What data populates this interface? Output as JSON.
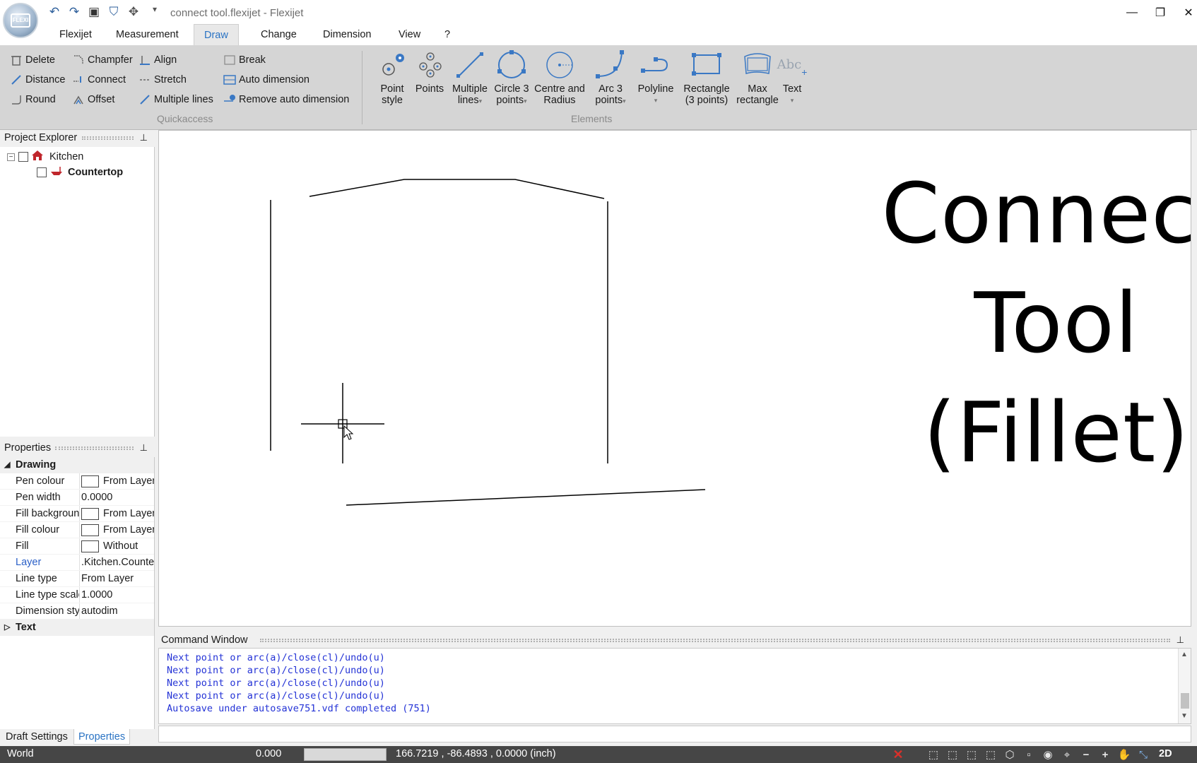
{
  "window": {
    "title": "connect tool.flexijet  -  Flexijet",
    "minimize_glyph": "—",
    "restore_glyph": "❐",
    "close_glyph": "✕",
    "orb_text": "FLEXI"
  },
  "quick_access": {
    "undo_icon": "↶",
    "redo_icon": "↷",
    "save_icon": "▣",
    "device_icon": "⛉",
    "gamepad_icon": "✥",
    "dropdown_icon": "▾"
  },
  "menu": {
    "tabs": [
      "Flexijet",
      "Measurement",
      "Draw",
      "Change",
      "Dimension",
      "View",
      "?"
    ],
    "active": "Draw"
  },
  "ribbon": {
    "quickaccess": {
      "label": "Quickaccess",
      "items": [
        "Delete",
        "Champfer",
        "Align",
        "Break",
        "Distance",
        "Connect",
        "Stretch",
        "Auto dimension",
        "Round",
        "Offset",
        "Multiple lines",
        "Remove auto dimension"
      ]
    },
    "elements": {
      "label": "Elements",
      "buttons": [
        {
          "line1": "Point",
          "line2": "style",
          "caret": ""
        },
        {
          "line1": "Points",
          "line2": "",
          "caret": ""
        },
        {
          "line1": "Multiple",
          "line2": "lines",
          "caret": "▾"
        },
        {
          "line1": "Circle 3",
          "line2": "points",
          "caret": "▾"
        },
        {
          "line1": "Centre and",
          "line2": "Radius",
          "caret": ""
        },
        {
          "line1": "Arc 3",
          "line2": "points",
          "caret": "▾"
        },
        {
          "line1": "Polyline",
          "line2": "",
          "caret": "▾"
        },
        {
          "line1": "Rectangle",
          "line2": "(3 points)",
          "caret": ""
        },
        {
          "line1": "Max",
          "line2": "rectangle",
          "caret": ""
        },
        {
          "line1": "Text",
          "line2": "",
          "caret": "▾"
        }
      ],
      "text_icon": "Abc"
    }
  },
  "project_explorer": {
    "title": "Project Explorer",
    "pin": "⊥",
    "expander": "−",
    "tree": [
      {
        "label": "Kitchen",
        "bold": false
      },
      {
        "label": "Countertop",
        "bold": true
      }
    ]
  },
  "properties": {
    "title": "Properties",
    "pin": "⊥",
    "category_drawing": "Drawing",
    "category_text": "Text",
    "tri_open": "◢",
    "tri_closed": "▷",
    "rows": [
      {
        "name": "Pen colour",
        "value": "From Layer",
        "swatch": true,
        "link": false
      },
      {
        "name": "Pen width",
        "value": "0.0000",
        "swatch": false,
        "link": false
      },
      {
        "name": "Fill background",
        "value": "From Layer",
        "swatch": true,
        "link": false
      },
      {
        "name": "Fill colour",
        "value": "From Layer",
        "swatch": true,
        "link": false
      },
      {
        "name": "Fill",
        "value": "Without",
        "swatch": true,
        "link": false
      },
      {
        "name": "Layer",
        "value": ".Kitchen.Countertop",
        "swatch": false,
        "link": true
      },
      {
        "name": "Line type",
        "value": "From Layer",
        "swatch": false,
        "link": false
      },
      {
        "name": "Line type scale",
        "value": "1.0000",
        "swatch": false,
        "link": false
      },
      {
        "name": "Dimension style",
        "value": "autodim",
        "swatch": false,
        "link": false
      }
    ]
  },
  "bottom_tabs": [
    "Draft Settings",
    "Properties"
  ],
  "canvas": {
    "overlay_lines": [
      "Connect",
      "Tool",
      "(Fillet)"
    ]
  },
  "command_window": {
    "title": "Command Window",
    "pin": "⊥",
    "lines": [
      "Next point or arc(a)/close(cl)/undo(u)",
      "Next point or arc(a)/close(cl)/undo(u)",
      "Next point or arc(a)/close(cl)/undo(u)",
      "Next point or arc(a)/close(cl)/undo(u)",
      "Autosave under autosave751.vdf completed (751)"
    ],
    "scroll_up": "▲",
    "scroll_down": "▼"
  },
  "status": {
    "space": "World",
    "value": "0.000",
    "coords": "166.7219 , -86.4893 , 0.0000 (inch)",
    "mode": "2D",
    "close_icon": "✕",
    "tool_icons": [
      "⬚",
      "⬚",
      "⬚",
      "⬚",
      "⬡",
      "▫",
      "◉",
      "⌖",
      "−",
      "+",
      "✋",
      "⤡"
    ]
  },
  "colors": {
    "accent": "#2a73c4",
    "command_text": "#2433d6",
    "status_bar": "#464646",
    "ribbon": "#d5d5d5",
    "close_red": "#d9302a"
  }
}
